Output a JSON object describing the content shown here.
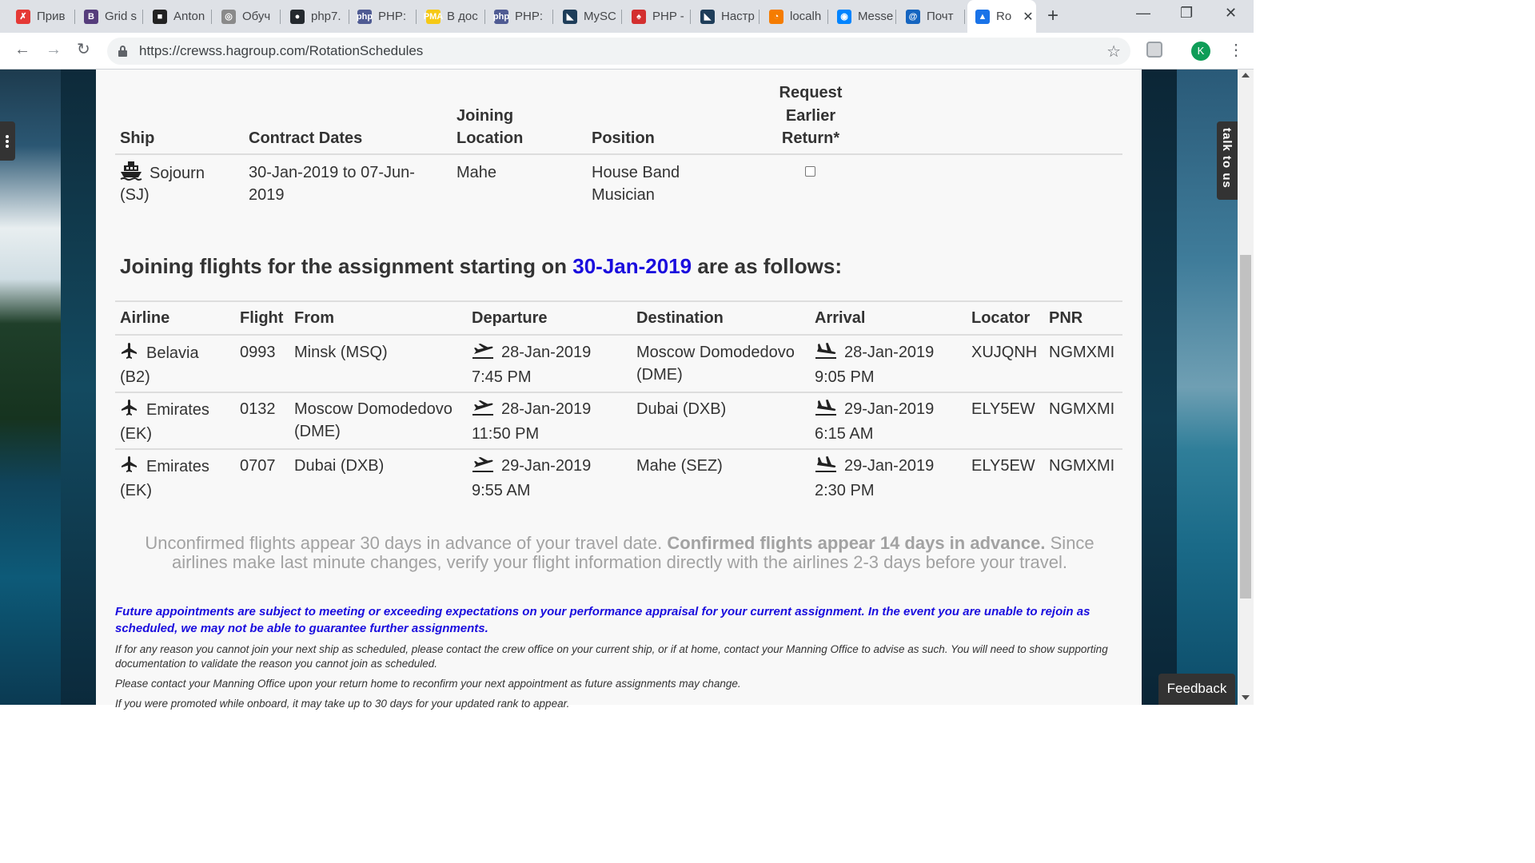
{
  "browser": {
    "tabs": [
      {
        "label": "Прив",
        "favicon_color": "#e53935",
        "favicon_glyph": "✗"
      },
      {
        "label": "Grid s",
        "favicon_color": "#563d7c",
        "favicon_glyph": "B"
      },
      {
        "label": "Anton",
        "favicon_color": "#222222",
        "favicon_glyph": "■"
      },
      {
        "label": "Обуч",
        "favicon_color": "#8a8a8a",
        "favicon_glyph": "◎"
      },
      {
        "label": "php7.",
        "favicon_color": "#24292e",
        "favicon_glyph": "●"
      },
      {
        "label": "PHP: ",
        "favicon_color": "#4f5b93",
        "favicon_glyph": "php"
      },
      {
        "label": "В дос",
        "favicon_color": "#f6c915",
        "favicon_glyph": "PMA"
      },
      {
        "label": "PHP: ",
        "favicon_color": "#4f5b93",
        "favicon_glyph": "php"
      },
      {
        "label": "MySC",
        "favicon_color": "#1e3d59",
        "favicon_glyph": "◣"
      },
      {
        "label": "PHP -",
        "favicon_color": "#d32f2f",
        "favicon_glyph": "♠"
      },
      {
        "label": "Настр",
        "favicon_color": "#1e3d59",
        "favicon_glyph": "◣"
      },
      {
        "label": "localh",
        "favicon_color": "#f57c00",
        "favicon_glyph": "◔"
      },
      {
        "label": "Messe",
        "favicon_color": "#0084ff",
        "favicon_glyph": "◉"
      },
      {
        "label": "Почт",
        "favicon_color": "#1565c0",
        "favicon_glyph": "@"
      },
      {
        "label": "Ro",
        "favicon_color": "#1a73e8",
        "favicon_glyph": "▲"
      }
    ],
    "new_tab_symbol": "+",
    "url": "https://crewss.hagroup.com/RotationSchedules",
    "profile_initial": "K"
  },
  "assignment_table": {
    "headers": {
      "ship": "Ship",
      "contract_dates": "Contract Dates",
      "joining_location_l1": "Joining",
      "joining_location_l2": "Location",
      "position": "Position",
      "request_l1": "Request",
      "request_l2": "Earlier",
      "request_l3": "Return*"
    },
    "row": {
      "ship_l1": "Sojourn",
      "ship_l2": "(SJ)",
      "dates_l1": "30-Jan-2019 to 07-Jun-",
      "dates_l2": "2019",
      "location": "Mahe",
      "position_l1": "House Band",
      "position_l2": "Musician",
      "request_earlier_return": false
    }
  },
  "heading": {
    "before": "Joining flights for the assignment starting on ",
    "date": "30-Jan-2019",
    "after": " are as follows:"
  },
  "flights_table": {
    "headers": {
      "airline": "Airline",
      "flight": "Flight",
      "from": "From",
      "departure": "Departure",
      "destination": "Destination",
      "arrival": "Arrival",
      "locator": "Locator",
      "pnr": "PNR"
    },
    "rows": [
      {
        "airline": "Belavia",
        "code": "(B2)",
        "flight": "0993",
        "from_l1": "Minsk (MSQ)",
        "from_l2": "",
        "dep_date": "28-Jan-2019",
        "dep_time": "7:45 PM",
        "dest_l1": "Moscow Domodedovo",
        "dest_l2": "(DME)",
        "arr_date": "28-Jan-2019",
        "arr_time": "9:05 PM",
        "locator": "XUJQNH",
        "pnr": "NGMXMI"
      },
      {
        "airline": "Emirates",
        "code": "(EK)",
        "flight": "0132",
        "from_l1": "Moscow Domodedovo",
        "from_l2": "(DME)",
        "dep_date": "28-Jan-2019",
        "dep_time": "11:50 PM",
        "dest_l1": "Dubai (DXB)",
        "dest_l2": "",
        "arr_date": "29-Jan-2019",
        "arr_time": "6:15 AM",
        "locator": "ELY5EW",
        "pnr": "NGMXMI"
      },
      {
        "airline": "Emirates",
        "code": "(EK)",
        "flight": "0707",
        "from_l1": "Dubai (DXB)",
        "from_l2": "",
        "dep_date": "29-Jan-2019",
        "dep_time": "9:55 AM",
        "dest_l1": "Mahe (SEZ)",
        "dest_l2": "",
        "arr_date": "29-Jan-2019",
        "arr_time": "2:30 PM",
        "locator": "ELY5EW",
        "pnr": "NGMXMI"
      }
    ]
  },
  "info": {
    "part1": "Unconfirmed flights appear 30 days in advance of your travel date. ",
    "bold": "Confirmed flights appear 14 days in advance.",
    "part2": " Since airlines make last minute changes, verify your flight information directly with the airlines 2-3 days before your travel."
  },
  "notes": {
    "blue": "Future appointments are subject to meeting or exceeding expectations on your performance appraisal for your current assignment. In the event you are unable to rejoin as scheduled, we may not be able to guarantee further assignments.",
    "n1": "If for any reason you cannot join your next ship as scheduled, please contact the crew office on your current ship, or if at home, contact your Manning Office to advise as such. You will need to show supporting documentation to validate the reason you cannot join as scheduled.",
    "n2": "Please contact your Manning Office upon your return home to reconfirm your next appointment as future assignments may change.",
    "n3": "If you were promoted while onboard, it may take up to 30 days for your updated rank to appear."
  },
  "widgets": {
    "talk_to_us": "talk to us",
    "feedback": "Feedback"
  },
  "colors": {
    "accent_blue": "#1a0dde",
    "text": "#333333",
    "muted": "#a2a2a2",
    "panel_bg": "#f8f8f8"
  }
}
